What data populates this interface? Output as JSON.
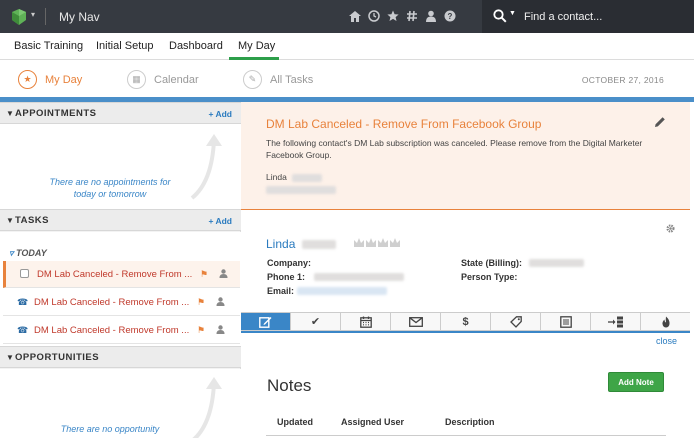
{
  "topbar": {
    "nav_title": "My Nav",
    "icons": [
      "home-icon",
      "clock-icon",
      "star-icon",
      "hashtag-icon",
      "person-icon",
      "help-icon"
    ],
    "search_placeholder": "Find a contact..."
  },
  "subnav": {
    "items": [
      "Basic Training",
      "Initial Setup",
      "Dashboard",
      "My Day"
    ],
    "active": "My Day"
  },
  "tabs": {
    "items": [
      "My Day",
      "Calendar",
      "All Tasks"
    ],
    "date": "OCTOBER 27, 2016"
  },
  "left": {
    "appointments": {
      "title": "APPOINTMENTS",
      "add": "+ Add",
      "empty_text": "There are no appointments for today or tomorrow"
    },
    "tasks": {
      "title": "TASKS",
      "add": "+ Add",
      "group": "TODAY",
      "rows": [
        {
          "label": "DM Lab Canceled - Remove From ...",
          "icon": "checkbox"
        },
        {
          "label": "DM Lab Canceled - Remove From ...",
          "icon": "phone-icon"
        },
        {
          "label": "DM Lab Canceled - Remove From ...",
          "icon": "phone-icon"
        }
      ]
    },
    "opportunities": {
      "title": "OPPORTUNITIES",
      "empty_text": "There are no opportunity"
    }
  },
  "banner": {
    "title": "DM Lab Canceled - Remove From Facebook Group",
    "text": "The following contact's DM Lab subscription was canceled. Please remove from the Digital Marketer Facebook Group.",
    "name": "Linda"
  },
  "contact": {
    "first_name": "Linda",
    "labels": {
      "company": "Company:",
      "phone": "Phone 1:",
      "email": "Email:",
      "state": "State (Billing):",
      "person_type": "Person Type:"
    }
  },
  "toolbar": {
    "tools": [
      "note-icon",
      "check-icon",
      "calendar-icon",
      "email-icon",
      "dollar-icon",
      "tag-icon",
      "document-icon",
      "sequence-icon",
      "fire-icon"
    ],
    "close": "close"
  },
  "notes": {
    "title": "Notes",
    "add_button": "Add Note",
    "columns": [
      "Updated",
      "Assigned User",
      "Description"
    ]
  },
  "colors": {
    "accent_orange": "#e8823c",
    "link_blue": "#2a7bbf",
    "active_green": "#2d9f4a",
    "topbar": "#363a41"
  }
}
